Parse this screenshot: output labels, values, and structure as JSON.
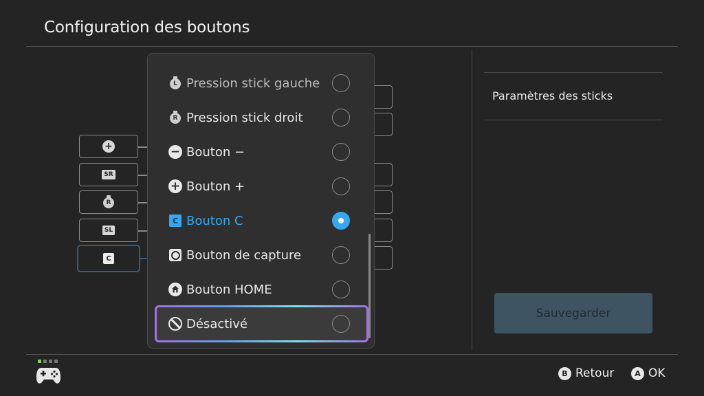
{
  "header": {
    "title": "Configuration des boutons"
  },
  "left_column": {
    "items": [
      {
        "name": "plus",
        "glyph": "+"
      },
      {
        "name": "sr",
        "glyph": "SR"
      },
      {
        "name": "right-stick",
        "glyph": "R"
      },
      {
        "name": "sl",
        "glyph": "SL"
      },
      {
        "name": "c",
        "glyph": "C"
      }
    ]
  },
  "dropdown": {
    "options": [
      {
        "label": "Pression stick gauche",
        "icon": "left-stick-press-icon",
        "glyph": "L",
        "selected": false
      },
      {
        "label": "Pression stick droit",
        "icon": "right-stick-press-icon",
        "glyph": "R",
        "selected": false
      },
      {
        "label": "Bouton −",
        "icon": "minus-button-icon",
        "glyph": "−",
        "selected": false
      },
      {
        "label": "Bouton +",
        "icon": "plus-button-icon",
        "glyph": "+",
        "selected": false
      },
      {
        "label": "Bouton C",
        "icon": "c-button-icon",
        "glyph": "C",
        "selected": true
      },
      {
        "label": "Bouton de capture",
        "icon": "capture-button-icon",
        "selected": false
      },
      {
        "label": "Bouton HOME",
        "icon": "home-button-icon",
        "selected": false
      },
      {
        "label": "Désactivé",
        "icon": "disabled-icon",
        "selected": false,
        "focused": true
      }
    ]
  },
  "right_panel": {
    "stick_settings_label": "Paramètres des sticks",
    "save_label": "Sauvegarder"
  },
  "footer": {
    "back": {
      "button": "B",
      "label": "Retour"
    },
    "ok": {
      "button": "A",
      "label": "OK"
    }
  },
  "colors": {
    "background": "#242424",
    "accent": "#35a8f0",
    "save_button_bg": "#3f5462",
    "selected_outline": "#3b5c78"
  }
}
